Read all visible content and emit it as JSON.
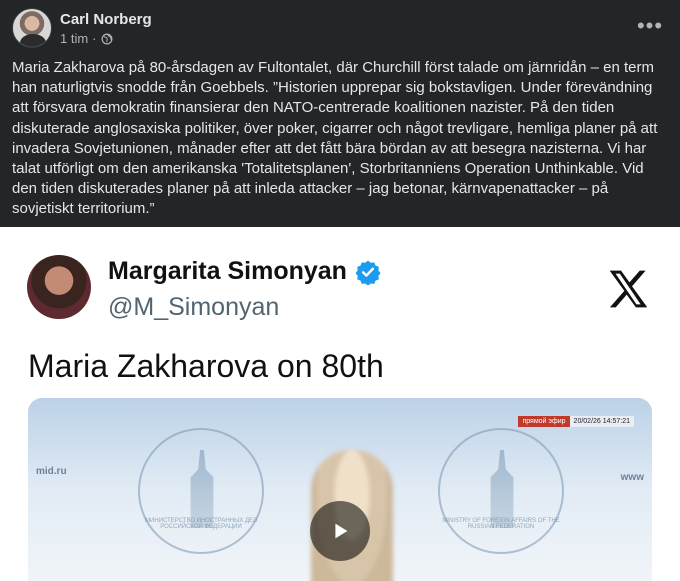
{
  "post": {
    "author": "Carl Norberg",
    "time": "1 tim",
    "separator": "·",
    "more_label": "•••",
    "text": "Maria Zakharova på 80-årsdagen av Fultontalet, där Churchill först talade om järnridån – en term han naturligtvis snodde från Goebbels. ”Historien upprepar sig bokstavligen. Under förevändning att försvara demokratin finansierar den NATO-centrerade koalitionen nazister. På den tiden diskuterade anglosaxiska politiker, över poker, cigarrer och något trevligare, hemliga planer på att invadera Sovjetunionen, månader efter att det fått bära bördan av att besegra nazisterna. Vi har talat utförligt om den amerikanska 'Totalitetsplanen', Storbritanniens Operation Unthinkable. Vid den tiden diskuterades planer på att inleda attacker – jag betonar, kärnvapenattacker – på sovjetiskt territorium.”"
  },
  "media": {
    "tweet_name": "Margarita Simonyan",
    "tweet_handle": "@M_Simonyan",
    "tweet_text": "Maria Zakharova on 80th",
    "video": {
      "live_label": "прямой эфир",
      "timestamp": "20/02/26  14:57:21",
      "watermark_left": "mid.ru",
      "watermark_right": "www",
      "emblem_caption_left": "МИНИСТЕРСТВО ИНОСТРАННЫХ ДЕЛ РОССИЙСКОЙ ФЕДЕРАЦИИ",
      "emblem_caption_right": "MINISTRY OF FOREIGN AFFAIRS OF THE RUSSIAN FEDERATION"
    }
  },
  "colors": {
    "background": "#242526",
    "verified": "#1d9bf0",
    "handle": "#536471"
  },
  "icons": {
    "privacy": "globe-icon",
    "more": "more-options-icon",
    "verified": "verified-badge-icon",
    "brand": "x-logo-icon",
    "play": "play-icon"
  }
}
